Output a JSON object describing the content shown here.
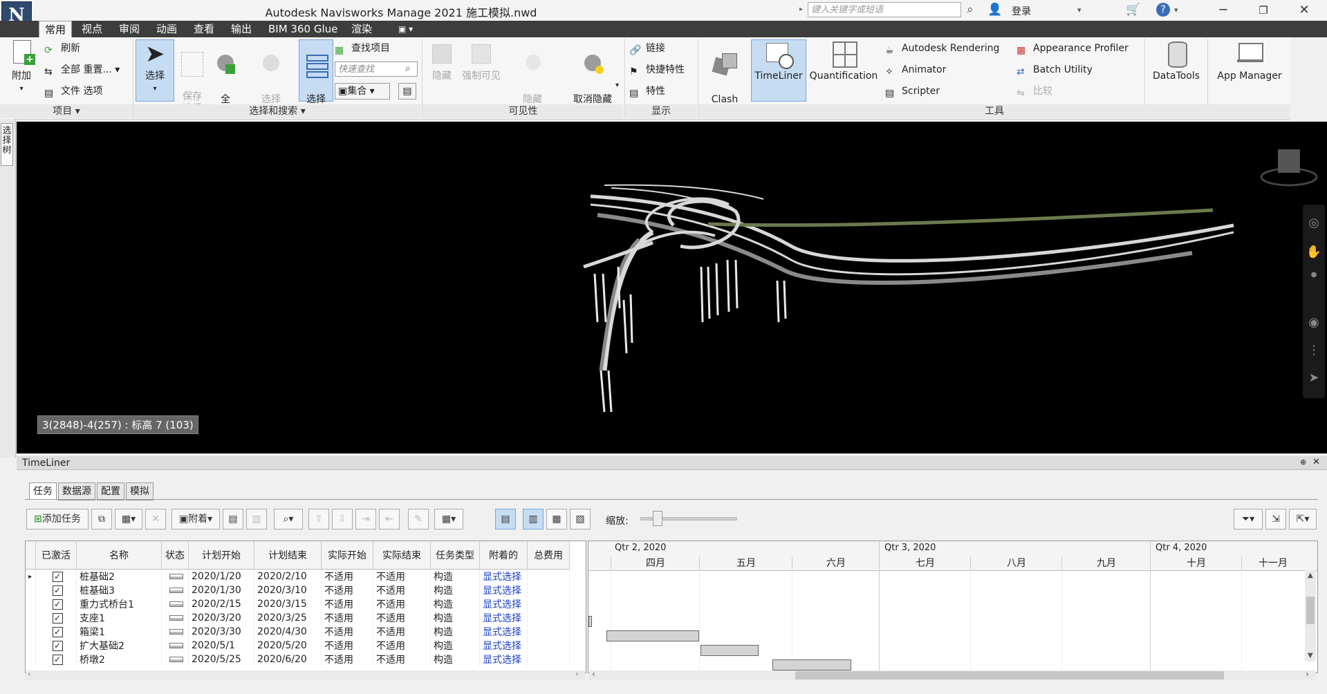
{
  "app": {
    "logo": "N",
    "title": "Autodesk Navisworks Manage 2021    施工模拟.nwd",
    "search_placeholder": "键入关键字或短语",
    "login": "登录"
  },
  "tabs": [
    "常用",
    "视点",
    "审阅",
    "动画",
    "查看",
    "输出",
    "BIM 360 Glue",
    "渲染"
  ],
  "ribbon": {
    "project": {
      "append": "附加",
      "refresh": "刷新",
      "reset_all": "全部 重置...",
      "file_options": "文件 选项",
      "panel": "项目 ▾"
    },
    "select": {
      "select": "选择",
      "save_select": "保存\n选择",
      "select_all": "全\n选",
      "select_same": "选择\n相同对象",
      "select_tree": "选择\n树",
      "find_items": "查找项目",
      "quick_find_placeholder": "快速查找",
      "sets": "集合",
      "panel": "选择和搜索 ▾"
    },
    "visibility": {
      "hide": "隐藏",
      "require": "强制可见",
      "hide_unselected": "隐藏\n未选定对象",
      "unhide_all": "取消隐藏\n所有对象",
      "panel": "可见性"
    },
    "display": {
      "links": "链接",
      "quick_props": "快捷特性",
      "properties": "特性",
      "panel": "显示"
    },
    "tools": {
      "clash": "Clash\nDetective",
      "timeliner": "TimeLiner",
      "quantification": "Quantification",
      "rendering": "Autodesk Rendering",
      "animator": "Animator",
      "scripter": "Scripter",
      "appearance": "Appearance Profiler",
      "batch": "Batch Utility",
      "compare": "比较",
      "datatools": "DataTools",
      "appmanager": "App Manager",
      "panel": "工具"
    }
  },
  "left_dock": {
    "select_tree_tab": "选\n择\n树"
  },
  "viewport": {
    "status_label": "3(2848)-4(257) : 标高 7 (103)"
  },
  "timeliner": {
    "title": "TimeLiner",
    "tabs": [
      "任务",
      "数据源",
      "配置",
      "模拟"
    ],
    "toolbar": {
      "add_task": "添加任务",
      "attach": "附着",
      "zoom": "缩放:"
    },
    "columns": [
      "已激活",
      "名称",
      "状态",
      "计划开始",
      "计划结束",
      "实际开始",
      "实际结束",
      "任务类型",
      "附着的",
      "总费用"
    ],
    "rows": [
      {
        "name": "桩基础2",
        "start": "2020/1/20",
        "end": "2020/2/10",
        "astart": "不适用",
        "aend": "不适用",
        "type": "构造",
        "attached": "显式选择"
      },
      {
        "name": "桩基础3",
        "start": "2020/1/30",
        "end": "2020/3/10",
        "astart": "不适用",
        "aend": "不适用",
        "type": "构造",
        "attached": "显式选择"
      },
      {
        "name": "重力式桥台1",
        "start": "2020/2/15",
        "end": "2020/3/15",
        "astart": "不适用",
        "aend": "不适用",
        "type": "构造",
        "attached": "显式选择"
      },
      {
        "name": "支座1",
        "start": "2020/3/20",
        "end": "2020/3/25",
        "astart": "不适用",
        "aend": "不适用",
        "type": "构造",
        "attached": "显式选择"
      },
      {
        "name": "箱梁1",
        "start": "2020/3/30",
        "end": "2020/4/30",
        "astart": "不适用",
        "aend": "不适用",
        "type": "构造",
        "attached": "显式选择"
      },
      {
        "name": "扩大基础2",
        "start": "2020/5/1",
        "end": "2020/5/20",
        "astart": "不适用",
        "aend": "不适用",
        "type": "构造",
        "attached": "显式选择"
      },
      {
        "name": "桥墩2",
        "start": "2020/5/25",
        "end": "2020/6/20",
        "astart": "不适用",
        "aend": "不适用",
        "type": "构造",
        "attached": "显式选择"
      }
    ],
    "gantt": {
      "quarters": [
        "Qtr 2, 2020",
        "Qtr 3, 2020",
        "Qtr 4, 2020"
      ],
      "months": [
        "四月",
        "五月",
        "六月",
        "七月",
        "八月",
        "九月",
        "十月",
        "十一月"
      ]
    }
  }
}
